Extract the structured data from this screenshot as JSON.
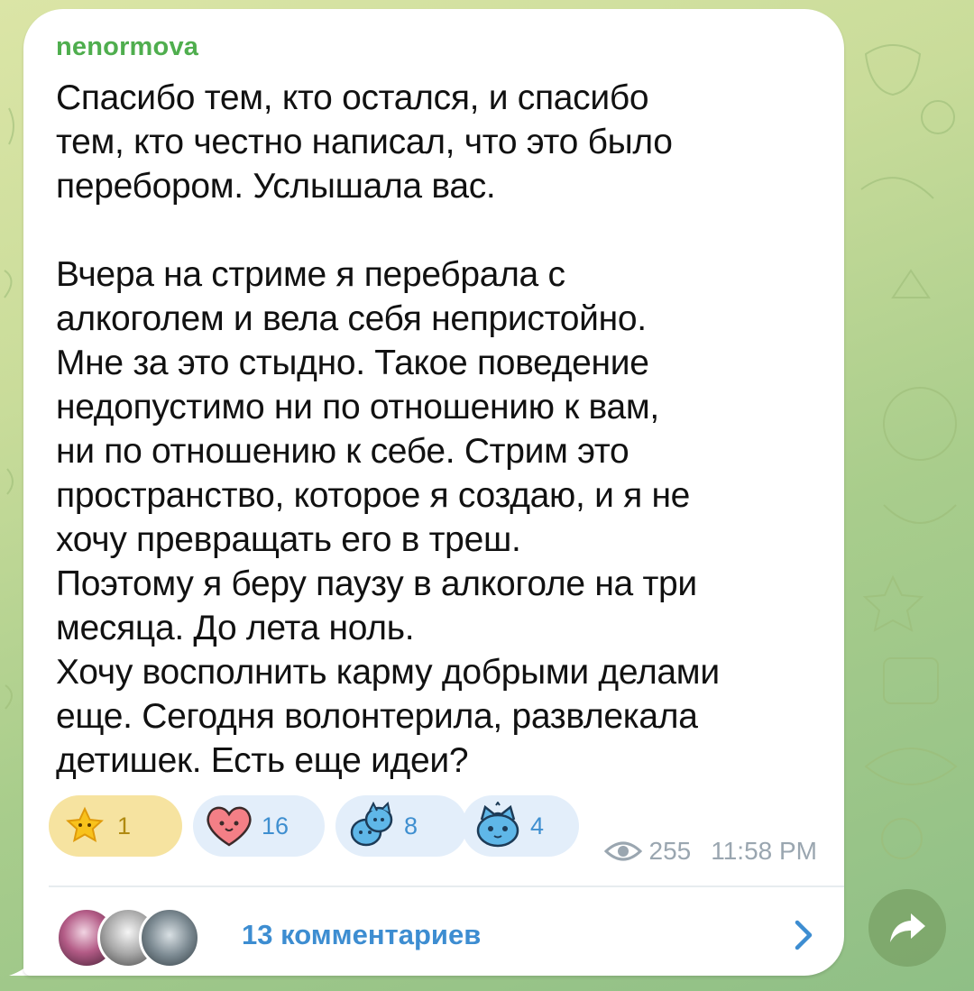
{
  "post": {
    "sender_name": "nenormova",
    "text": "Спасибо тем, кто остался, и спасибо\nтем, кто честно написал, что это было\nперебором. Услышала вас.\n\nВчера на стриме я перебрала с\nалкоголем и вела себя непристойно.\nМне за это стыдно. Такое поведение\nнедопустимо ни по отношению к вам,\nни по отношению к себе. Стрим это\nпространство, которое я создаю, и я не\nхочу превращать его в треш.\nПоэтому я беру паузу в алкоголе на три\nмесяца. До лета ноль.\nХочу восполнить карму добрыми делами\nеще. Сегодня волонтерила, развлекала\nдетишек. Есть еще идеи?",
    "reactions": [
      {
        "icon": "star-emoji-icon",
        "count": "1",
        "chosen": true
      },
      {
        "icon": "heart-emoji-icon",
        "count": "16",
        "chosen": false
      },
      {
        "icon": "blue-cat-hug-sticker-icon",
        "count": "8",
        "chosen": false
      },
      {
        "icon": "blue-cat-sticker-icon",
        "count": "4",
        "chosen": false
      }
    ],
    "views": "255",
    "time": "11:58 PM",
    "comments_label": "13 комментариев"
  },
  "colors": {
    "sender": "#4fae4e",
    "link": "#3d8dd1",
    "meta": "#9aa6b0",
    "bubble": "#ffffff"
  },
  "icons": {
    "views": "eye-icon",
    "comments_arrow": "chevron-right-icon",
    "share": "share-arrow-icon"
  }
}
